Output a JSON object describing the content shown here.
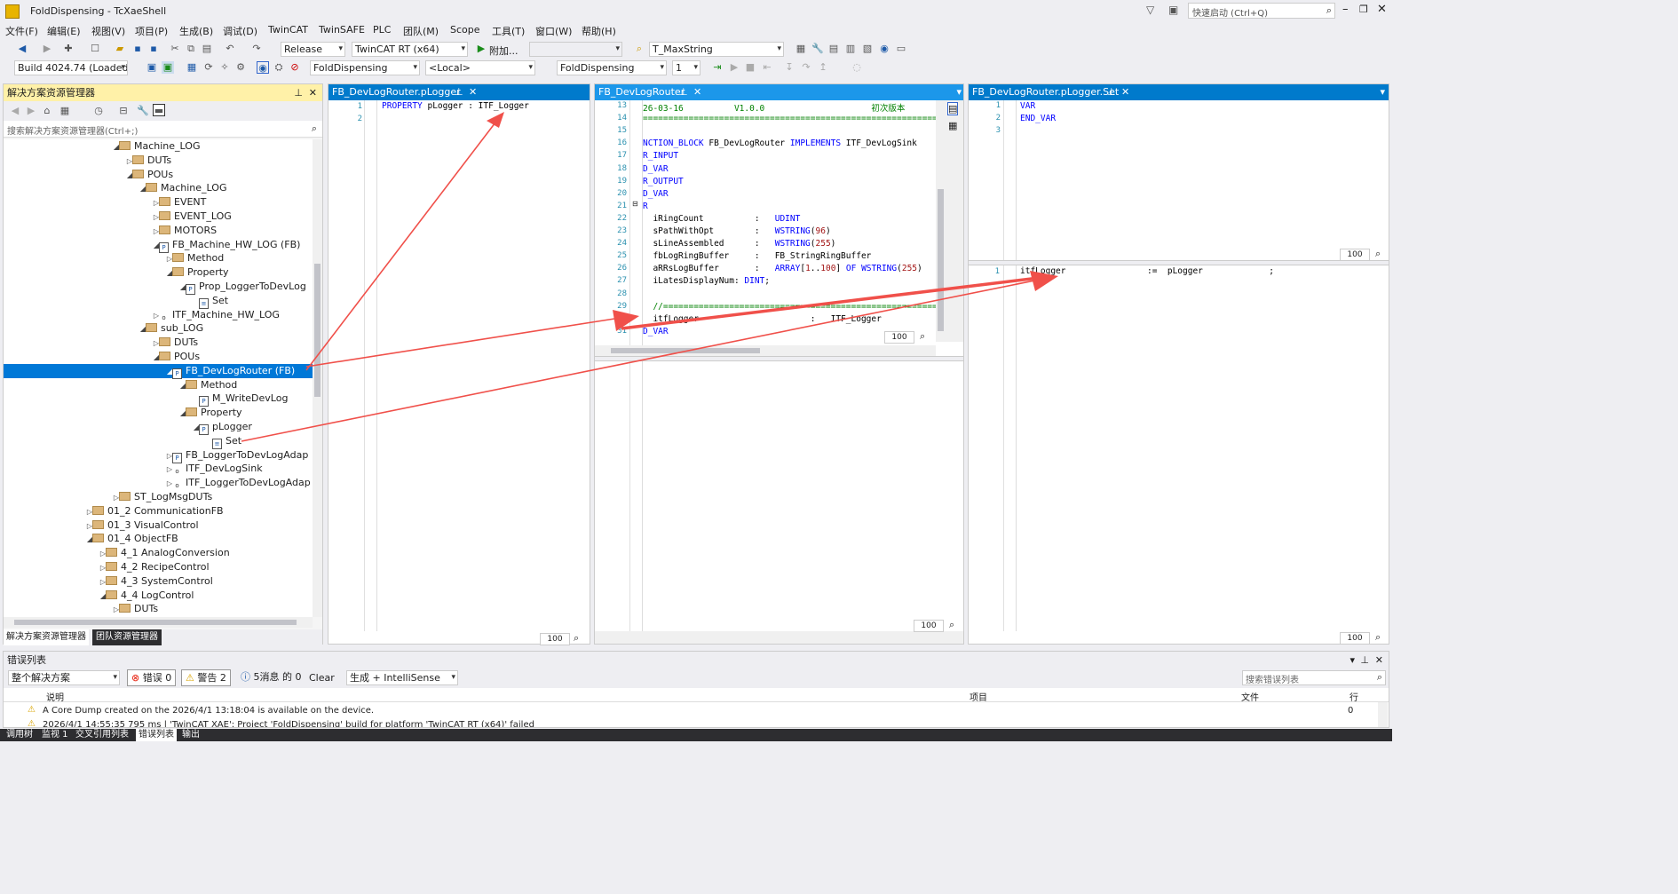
{
  "window": {
    "title": "FoldDispensing - TcXaeShell",
    "quick_launch_placeholder": "快速启动 (Ctrl+Q)"
  },
  "menus": [
    "文件(F)",
    "编辑(E)",
    "视图(V)",
    "项目(P)",
    "生成(B)",
    "调试(D)",
    "TwinCAT",
    "TwinSAFE",
    "PLC",
    "团队(M)",
    "Scope",
    "工具(T)",
    "窗口(W)",
    "帮助(H)"
  ],
  "toolbar": {
    "config": "Release",
    "platform": "TwinCAT RT (x64)",
    "attach": "附加...",
    "find": "T_MaxString",
    "build": "Build 4024.74 (Loaded",
    "project": "FoldDispensing",
    "target": "<Local>",
    "plc_project": "FoldDispensing",
    "task_index": "1"
  },
  "solution_explorer": {
    "title": "解决方案资源管理器",
    "search_placeholder": "搜索解决方案资源管理器(Ctrl+;)",
    "tabs": [
      "解决方案资源管理器",
      "团队资源管理器"
    ],
    "tree": [
      {
        "label": "Machine_LOG",
        "indent": 0,
        "type": "folder",
        "exp": "open"
      },
      {
        "label": "DUTs",
        "indent": 1,
        "type": "folder",
        "exp": "closed"
      },
      {
        "label": "POUs",
        "indent": 1,
        "type": "folder",
        "exp": "open"
      },
      {
        "label": "Machine_LOG",
        "indent": 2,
        "type": "folder",
        "exp": "open"
      },
      {
        "label": "EVENT",
        "indent": 3,
        "type": "folder",
        "exp": "closed"
      },
      {
        "label": "EVENT_LOG",
        "indent": 3,
        "type": "folder",
        "exp": "closed"
      },
      {
        "label": "MOTORS",
        "indent": 3,
        "type": "folder",
        "exp": "closed"
      },
      {
        "label": "FB_Machine_HW_LOG (FB)",
        "indent": 3,
        "type": "fb",
        "exp": "open"
      },
      {
        "label": "Method",
        "indent": 4,
        "type": "folder",
        "exp": "closed"
      },
      {
        "label": "Property",
        "indent": 4,
        "type": "folder",
        "exp": "open"
      },
      {
        "label": "Prop_LoggerToDevLog",
        "indent": 5,
        "type": "prop",
        "exp": "open"
      },
      {
        "label": "Set",
        "indent": 6,
        "type": "set",
        "exp": "none"
      },
      {
        "label": "ITF_Machine_HW_LOG",
        "indent": 3,
        "type": "itf",
        "exp": "closed"
      },
      {
        "label": "sub_LOG",
        "indent": 2,
        "type": "folder",
        "exp": "open"
      },
      {
        "label": "DUTs",
        "indent": 3,
        "type": "folder",
        "exp": "closed"
      },
      {
        "label": "POUs",
        "indent": 3,
        "type": "folder",
        "exp": "open"
      },
      {
        "label": "FB_DevLogRouter (FB)",
        "indent": 4,
        "type": "fb",
        "exp": "open",
        "selected": true
      },
      {
        "label": "Method",
        "indent": 5,
        "type": "folder",
        "exp": "open"
      },
      {
        "label": "M_WriteDevLog",
        "indent": 6,
        "type": "method",
        "exp": "none"
      },
      {
        "label": "Property",
        "indent": 5,
        "type": "folder",
        "exp": "open"
      },
      {
        "label": "pLogger",
        "indent": 6,
        "type": "prop",
        "exp": "open"
      },
      {
        "label": "Set",
        "indent": 7,
        "type": "set",
        "exp": "none"
      },
      {
        "label": "FB_LoggerToDevLogAdap",
        "indent": 4,
        "type": "fb",
        "exp": "closed"
      },
      {
        "label": "ITF_DevLogSink",
        "indent": 4,
        "type": "itf",
        "exp": "closed"
      },
      {
        "label": "ITF_LoggerToDevLogAdap",
        "indent": 4,
        "type": "itf",
        "exp": "closed"
      },
      {
        "label": "ST_LogMsgDUTs",
        "indent": 0,
        "type": "folder",
        "exp": "closed"
      },
      {
        "label": "01_2 CommunicationFB",
        "indent": -2,
        "type": "folder",
        "exp": "closed"
      },
      {
        "label": "01_3 VisualControl",
        "indent": -2,
        "type": "folder",
        "exp": "closed"
      },
      {
        "label": "01_4 ObjectFB",
        "indent": -2,
        "type": "folder",
        "exp": "open"
      },
      {
        "label": "4_1 AnalogConversion",
        "indent": -1,
        "type": "folder",
        "exp": "closed"
      },
      {
        "label": "4_2 RecipeControl",
        "indent": -1,
        "type": "folder",
        "exp": "closed"
      },
      {
        "label": "4_3 SystemControl",
        "indent": -1,
        "type": "folder",
        "exp": "closed"
      },
      {
        "label": "4_4 LogControl",
        "indent": -1,
        "type": "folder",
        "exp": "open"
      },
      {
        "label": "DUTs",
        "indent": 0,
        "type": "folder",
        "exp": "closed"
      }
    ]
  },
  "editor1": {
    "tab": "FB_DevLogRouter.pLogger",
    "lines": [
      "1",
      "2"
    ],
    "code": [
      [
        {
          "t": "PROPERTY",
          "c": "kw"
        },
        {
          "t": " pLogger : ITF_Logger",
          "c": ""
        }
      ],
      []
    ],
    "zoom": "100"
  },
  "editor2": {
    "tab": "FB_DevLogRouter",
    "lines": [
      "13",
      "14",
      "15",
      "16",
      "17",
      "18",
      "19",
      "20",
      "21",
      "22",
      "23",
      "24",
      "25",
      "26",
      "27",
      "28",
      "29",
      "30",
      "31"
    ],
    "code": [
      [
        {
          "t": "26-03-16          V1.0.0",
          "c": "cm"
        },
        {
          "t": "                     初次版本",
          "c": "cm"
        }
      ],
      [
        {
          "t": "==================================================================",
          "c": "cm"
        }
      ],
      [],
      [
        {
          "t": "NCTION_BLOCK",
          "c": "kw"
        },
        {
          "t": " FB_DevLogRouter ",
          "c": ""
        },
        {
          "t": "IMPLEMENTS",
          "c": "kw"
        },
        {
          "t": " ITF_DevLogSink",
          "c": ""
        }
      ],
      [
        {
          "t": "R_INPUT",
          "c": "kw"
        }
      ],
      [
        {
          "t": "D_VAR",
          "c": "kw"
        }
      ],
      [
        {
          "t": "R_OUTPUT",
          "c": "kw"
        }
      ],
      [
        {
          "t": "D_VAR",
          "c": "kw"
        }
      ],
      [
        {
          "t": "R",
          "c": "kw"
        }
      ],
      [
        {
          "t": "  iRingCount          :   ",
          "c": ""
        },
        {
          "t": "UDINT",
          "c": "kw"
        }
      ],
      [
        {
          "t": "  sPathWithOpt        :   ",
          "c": ""
        },
        {
          "t": "WSTRING",
          "c": "kw"
        },
        {
          "t": "(",
          "c": ""
        },
        {
          "t": "96",
          "c": "num"
        },
        {
          "t": ")",
          "c": ""
        }
      ],
      [
        {
          "t": "  sLineAssembled      :   ",
          "c": ""
        },
        {
          "t": "WSTRING",
          "c": "kw"
        },
        {
          "t": "(",
          "c": ""
        },
        {
          "t": "255",
          "c": "num"
        },
        {
          "t": ")",
          "c": ""
        }
      ],
      [
        {
          "t": "  fbLogRingBuffer     :   FB_StringRingBuffer",
          "c": ""
        }
      ],
      [
        {
          "t": "  aRRsLogBuffer       :   ",
          "c": ""
        },
        {
          "t": "ARRAY",
          "c": "kw"
        },
        {
          "t": "[",
          "c": ""
        },
        {
          "t": "1",
          "c": "num"
        },
        {
          "t": "..",
          "c": ""
        },
        {
          "t": "100",
          "c": "num"
        },
        {
          "t": "] ",
          "c": ""
        },
        {
          "t": "OF",
          "c": "kw"
        },
        {
          "t": " ",
          "c": ""
        },
        {
          "t": "WSTRING",
          "c": "kw"
        },
        {
          "t": "(",
          "c": ""
        },
        {
          "t": "255",
          "c": "num"
        },
        {
          "t": ")",
          "c": ""
        }
      ],
      [
        {
          "t": "  iLatesDisplayNum: ",
          "c": ""
        },
        {
          "t": "DINT",
          "c": "kw"
        },
        {
          "t": ";",
          "c": ""
        }
      ],
      [],
      [
        {
          "t": "  //==============================================================",
          "c": "cm"
        }
      ],
      [
        {
          "t": "  itfLogger                      :   ITF_Logger",
          "c": ""
        }
      ],
      [
        {
          "t": "D_VAR",
          "c": "kw"
        }
      ]
    ],
    "zoom_top": "100",
    "zoom_bottom": "100"
  },
  "editor3": {
    "tab": "FB_DevLogRouter.pLogger.Set",
    "lines": [
      "1",
      "2",
      "3"
    ],
    "code": [
      [
        {
          "t": "VAR",
          "c": "kw"
        }
      ],
      [
        {
          "t": "END_VAR",
          "c": "kw"
        }
      ],
      []
    ],
    "body_lines": [
      "1"
    ],
    "body_code": [
      [
        {
          "t": "itfLogger                :=  pLogger             ;",
          "c": ""
        }
      ]
    ],
    "zoom_top": "100",
    "zoom_bottom": "100"
  },
  "error_list": {
    "title": "错误列表",
    "scope": "整个解决方案",
    "errors": "错误 0",
    "warnings": "警告 2",
    "messages": "5消息 的 0",
    "clear": "Clear",
    "filter": "生成 + IntelliSense",
    "search_placeholder": "搜索错误列表",
    "col_desc": "说明",
    "col_project": "项目",
    "col_file": "文件",
    "col_line": "行",
    "rows": [
      {
        "desc": "A Core Dump created on the 2026/4/1 13:18:04 is available on the device.",
        "line": "0"
      },
      {
        "desc": "2026/4/1 14:55:35 795 ms | 'TwinCAT XAE': Project 'FoldDispensing' build for platform 'TwinCAT RT (x64)' failed",
        "line": ""
      }
    ]
  },
  "bottom_tabs": [
    "调用树",
    "监视 1",
    "交叉引用列表",
    "错误列表",
    "输出"
  ],
  "colors": {
    "accent": "#007acc",
    "selection": "#0078d7",
    "arrow": "#f0504a",
    "keyword": "#0000ff"
  }
}
